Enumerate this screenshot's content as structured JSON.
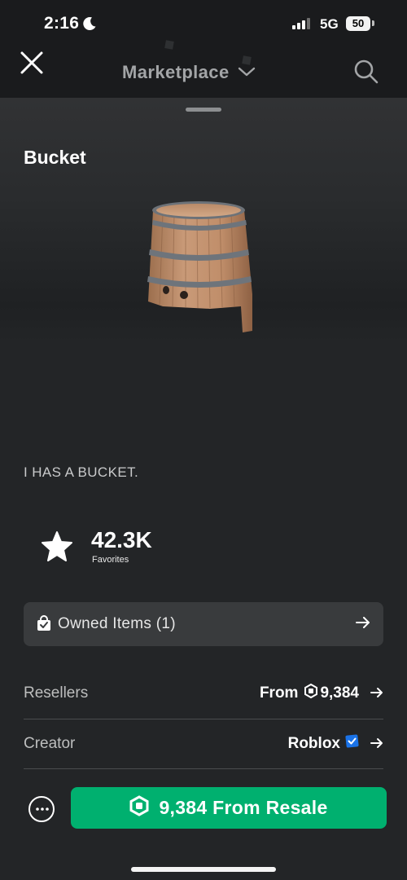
{
  "status_bar": {
    "time": "2:16",
    "network": "5G",
    "battery": "50",
    "icons": [
      "moon-icon",
      "cellular-signal-icon"
    ]
  },
  "nav": {
    "title": "Marketplace",
    "icons": [
      "close-icon",
      "chevron-down-icon",
      "search-icon"
    ]
  },
  "item": {
    "name": "Bucket",
    "description": "I HAS A BUCKET.",
    "favorites_count": "42.3K",
    "favorites_label": "Favorites"
  },
  "owned": {
    "label": "Owned Items (1)",
    "icons": [
      "bag-icon",
      "arrow-right-icon"
    ]
  },
  "resellers": {
    "label": "Resellers",
    "prefix": "From",
    "price": "9,384"
  },
  "creator": {
    "label": "Creator",
    "name": "Roblox"
  },
  "actions": {
    "buy_label": "9,384 From Resale",
    "icons": [
      "more-icon",
      "robux-icon"
    ]
  },
  "colors": {
    "background": "#232527",
    "buy_button": "#00b06f",
    "verified_badge": "#1a73e8"
  }
}
